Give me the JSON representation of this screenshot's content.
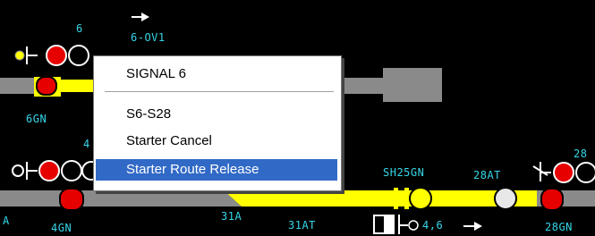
{
  "labels": {
    "signal_6": "6",
    "route_6_ov1": "6-OV1",
    "track_6gn": "6GN",
    "signal_4": "4",
    "track_4gn": "4GN",
    "track_31a": "31A",
    "track_31at": "31AT",
    "track_sh25gn": "SH25GN",
    "track_28at": "28AT",
    "signal_28": "28",
    "track_28gn": "28GN",
    "route_4_6": "4,6",
    "edge_a": "A"
  },
  "context_menu": {
    "title": "SIGNAL 6",
    "items": [
      "S6-S28",
      "Starter Cancel",
      "Starter Route Release"
    ],
    "selected_index": 2
  },
  "colors": {
    "background": "#000000",
    "label_cyan": "#35d6e8",
    "track_gray": "#8a8a8a",
    "route_yellow": "#ffff00",
    "signal_red": "#e60000",
    "menu_highlight": "#3169c6"
  },
  "icons": [
    "arrow-right-icon",
    "signal-head-icon",
    "buffer-stop-icon"
  ]
}
